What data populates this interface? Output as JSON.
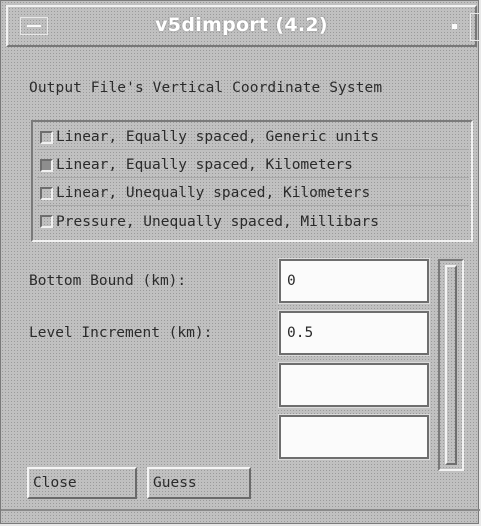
{
  "window": {
    "title": "v5dimport (4.2)"
  },
  "header": {
    "label": "Output File's Vertical Coordinate System"
  },
  "coordinate_options": [
    {
      "label": "Linear, Equally spaced, Generic units",
      "selected": false
    },
    {
      "label": "Linear, Equally spaced, Kilometers",
      "selected": true
    },
    {
      "label": "Linear, Unequally spaced, Kilometers",
      "selected": false
    },
    {
      "label": "Pressure, Unequally spaced, Millibars",
      "selected": false
    }
  ],
  "fields": {
    "bottom_bound": {
      "label": "Bottom Bound (km):",
      "value": "0"
    },
    "level_increment": {
      "label": "Level Increment (km):",
      "value": "0.5"
    },
    "extra1": {
      "value": ""
    },
    "extra2": {
      "value": ""
    }
  },
  "buttons": {
    "close": "Close",
    "guess": "Guess"
  },
  "icons": {
    "window_menu": "window-menu-icon",
    "minimize": "minimize-icon",
    "maximize": "maximize-icon"
  }
}
